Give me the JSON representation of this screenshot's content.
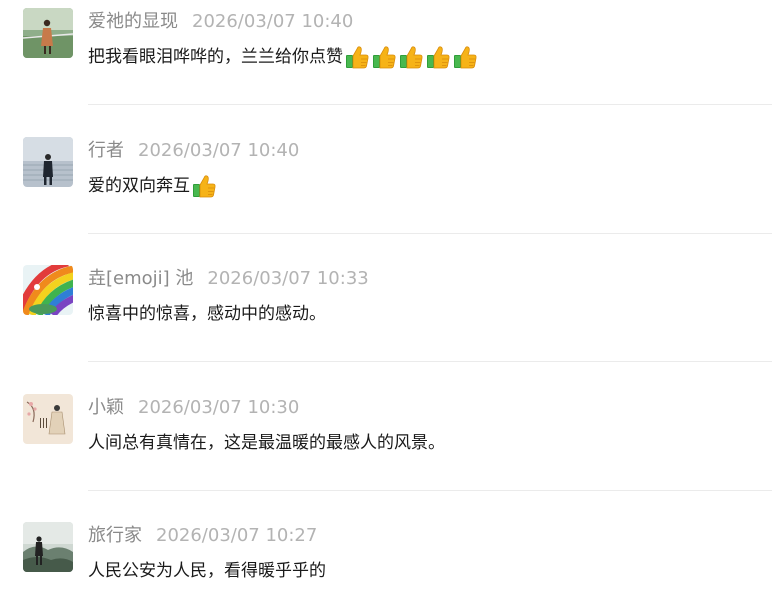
{
  "comments": [
    {
      "nickname": "爱祂的显现",
      "timestamp": "2026/03/07 10:40",
      "text": "把我看眼泪哗哗的，兰兰给你点赞",
      "emoji_icons": [
        "thumbs-up-icon",
        "thumbs-up-icon",
        "thumbs-up-icon",
        "thumbs-up-icon",
        "thumbs-up-icon"
      ]
    },
    {
      "nickname": "行者",
      "timestamp": "2026/03/07 10:40",
      "text": "爱的双向奔互",
      "emoji_icons": [
        "thumbs-up-icon"
      ]
    },
    {
      "nickname": "垚[emoji] 池",
      "timestamp": "2026/03/07 10:33",
      "text": "惊喜中的惊喜，感动中的感动。",
      "emoji_icons": []
    },
    {
      "nickname": "小颖",
      "timestamp": "2026/03/07 10:30",
      "text": "人间总有真情在，这是最温暖的最感人的风景。",
      "emoji_icons": []
    },
    {
      "nickname": "旅行家",
      "timestamp": "2026/03/07 10:27",
      "text": "人民公安为人民，看得暖乎乎的",
      "emoji_icons": []
    }
  ],
  "colors": {
    "nickname": "#8a8a8a",
    "timestamp": "#b3b3b3",
    "content": "#1a1a1a",
    "divider": "#ebebeb"
  }
}
